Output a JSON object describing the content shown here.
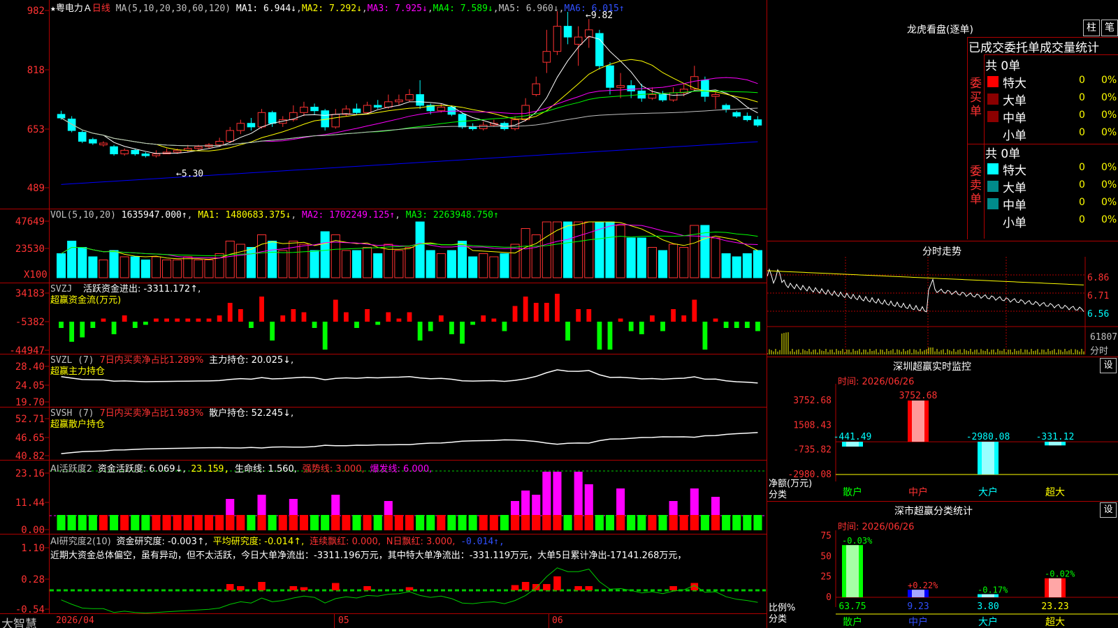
{
  "colors": {
    "up": "#ff3232",
    "down": "#00ffff",
    "grid": "#b00000",
    "ma1": "#ffffff",
    "ma2": "#ffff00",
    "ma3": "#ff00ff",
    "ma4": "#00ff00",
    "ma5": "#c0c0c0",
    "ma6": "#0000ff"
  },
  "header": {
    "stock_name": "粤电力Ａ",
    "period": "日线",
    "ma_params": "MA(5,10,20,30,60,120)",
    "ma1": "MA1: 6.944↓",
    "ma2": "MA2: 7.292↓",
    "ma3": "MA3: 7.925↓",
    "ma4": "MA4: 7.589↓",
    "ma5": "MA5: 6.960↓",
    "ma6": "MA6: 6.015↑"
  },
  "price_axis": [
    "982",
    "818",
    "653",
    "489"
  ],
  "annotations": {
    "high": "9.82",
    "low": "5.30"
  },
  "vol_header": {
    "label": "VOL(5,10,20)",
    "vol": "1635947.000↑",
    "ma1": "MA1: 1480683.375↓",
    "ma2": "MA2: 1702249.125↑",
    "ma3": "MA3: 2263948.750↑"
  },
  "vol_axis": [
    "47649",
    "23530",
    "X100"
  ],
  "svzj": {
    "label": "SVZJ",
    "text": "活跃资金进出: -3311.172↑,",
    "sub": "超赢资金流(万元)",
    "axis": [
      "34183",
      "-5382",
      "-44947"
    ]
  },
  "svzl": {
    "label": "SVZL (7)",
    "pct": "7日内买卖净占比1.289%",
    "hold": "主力持仓: 20.025↓,",
    "sub": "超赢主力持仓",
    "axis": [
      "28.40",
      "24.05",
      "19.70"
    ]
  },
  "svsh": {
    "label": "SVSH (7)",
    "pct": "7日内买卖净占比1.983%",
    "hold": "散户持仓: 52.245↓,",
    "sub": "超赢散户持仓",
    "axis": [
      "52.71",
      "46.65",
      "40.82"
    ]
  },
  "ai_active": {
    "label": "AI活跃度2",
    "a": "资金活跃度: 6.069↓,",
    "b": "23.159,",
    "c": "生命线: 1.560,",
    "d": "强势线: 3.000,",
    "e": "爆发线: 6.000,",
    "axis": [
      "23.16",
      "11.44",
      "0.00"
    ]
  },
  "ai_research": {
    "label": "AI研究度2(10)",
    "a": "资金研究度: -0.003↑,",
    "b": "平均研究度: -0.014↑,",
    "c": "连续飘红: 0.000,",
    "d": "N日飘红: 3.000,",
    "e": "-0.014↑,",
    "note": "近期大资金总体偏空，虽有异动，但不太活跃，今日大单净流出：-3311.196万元，其中特大单净流出：-331.119万元，大单5日累计净出-17141.268万元，",
    "axis": [
      "1.10",
      "0.28",
      "-0.54"
    ]
  },
  "bottom": {
    "brand": "大智慧",
    "date0": "2026/04",
    "m1": "05",
    "m2": "06"
  },
  "longhu": {
    "title": "龙虎看盘(逐单)",
    "btn1": "柱",
    "btn2": "笔",
    "subtitle": "已成交委托单成交量统计",
    "buy_label": "委买单",
    "sell_label": "委卖单",
    "buy_total": "共 0单",
    "sell_total": "共 0单",
    "rows": [
      "特大",
      "大单",
      "中单",
      "小单"
    ],
    "zero": "0",
    "pct": "0%"
  },
  "fenshi": {
    "title": "分时走势",
    "axis": [
      "6.86",
      "6.71",
      "6.56"
    ],
    "vol1": "61807",
    "vol2": "分时"
  },
  "sz_monitor": {
    "title": "深圳超赢实时监控",
    "time": "时间: 2026/06/26",
    "axis": [
      "3752.68",
      "1508.43",
      "-735.82",
      "-2980.08"
    ],
    "ylabel": "净额(万元)",
    "xlabel": "分类",
    "categories": [
      "散户",
      "中户",
      "大户",
      "超大"
    ],
    "values": [
      -441.49,
      3752.68,
      -2980.08,
      -331.12
    ],
    "labels": [
      "-441.49",
      "3752.68",
      "-2980.08",
      "-331.12"
    ],
    "set": "设"
  },
  "sz_class": {
    "title": "深市超赢分类统计",
    "time": "时间: 2026/06/26",
    "axis": [
      "75",
      "50",
      "25",
      "0"
    ],
    "ylabel": "比例%",
    "xlabel": "分类",
    "categories": [
      "散户",
      "中户",
      "大户",
      "超大"
    ],
    "values": [
      63.75,
      9.23,
      3.8,
      23.23
    ],
    "changes": [
      "-0.03%",
      "+0.22%",
      "-0.17%",
      "-0.02%"
    ],
    "labels": [
      "63.75",
      "9.23",
      "3.80",
      "23.23"
    ],
    "set": "设"
  },
  "chart_data": {
    "type": "candlestick",
    "title": "粤电力Ａ 日线",
    "ylim": [
      4.89,
      9.82
    ],
    "candles": [
      [
        6.95,
        6.85,
        7.05,
        6.8
      ],
      [
        6.82,
        6.5,
        6.9,
        6.45
      ],
      [
        6.45,
        6.2,
        6.5,
        6.15
      ],
      [
        6.25,
        6.15,
        6.3,
        6.1
      ],
      [
        6.1,
        6.15,
        6.2,
        6.05
      ],
      [
        6.05,
        5.85,
        6.1,
        5.8
      ],
      [
        5.85,
        5.95,
        6.0,
        5.8
      ],
      [
        5.95,
        5.85,
        6.0,
        5.8
      ],
      [
        5.85,
        5.8,
        5.9,
        5.75
      ],
      [
        5.8,
        5.85,
        5.95,
        5.75
      ],
      [
        5.85,
        5.9,
        6.0,
        5.85
      ],
      [
        5.9,
        5.95,
        6.0,
        5.85
      ],
      [
        5.95,
        6.0,
        6.1,
        5.9
      ],
      [
        6.0,
        6.05,
        6.1,
        5.95
      ],
      [
        6.05,
        6.1,
        6.15,
        6.0
      ],
      [
        6.1,
        6.2,
        6.3,
        6.05
      ],
      [
        6.2,
        6.5,
        6.6,
        6.15
      ],
      [
        6.5,
        6.7,
        6.8,
        6.4
      ],
      [
        6.7,
        6.6,
        6.85,
        6.5
      ],
      [
        6.6,
        7.0,
        7.1,
        6.55
      ],
      [
        7.0,
        6.7,
        7.05,
        6.6
      ],
      [
        6.7,
        6.8,
        6.9,
        6.6
      ],
      [
        6.8,
        7.0,
        7.2,
        6.75
      ],
      [
        7.0,
        7.15,
        7.3,
        6.9
      ],
      [
        7.15,
        7.05,
        7.25,
        6.95
      ],
      [
        7.05,
        6.6,
        7.1,
        6.5
      ],
      [
        6.6,
        6.95,
        7.1,
        6.55
      ],
      [
        6.95,
        7.1,
        7.2,
        6.9
      ],
      [
        7.1,
        7.0,
        7.25,
        6.95
      ],
      [
        7.0,
        7.2,
        7.3,
        6.95
      ],
      [
        7.2,
        7.15,
        7.35,
        7.1
      ],
      [
        7.15,
        7.3,
        7.5,
        7.1
      ],
      [
        7.3,
        7.35,
        7.5,
        7.2
      ],
      [
        7.35,
        7.5,
        7.65,
        7.3
      ],
      [
        7.5,
        7.2,
        7.9,
        7.1
      ],
      [
        7.2,
        7.05,
        7.25,
        6.95
      ],
      [
        7.05,
        7.15,
        7.25,
        7.0
      ],
      [
        7.15,
        6.95,
        7.2,
        6.9
      ],
      [
        6.95,
        6.6,
        7.0,
        6.55
      ],
      [
        6.6,
        6.55,
        6.7,
        6.5
      ],
      [
        6.55,
        6.65,
        6.75,
        6.5
      ],
      [
        6.65,
        6.7,
        6.8,
        6.6
      ],
      [
        6.7,
        6.55,
        6.75,
        6.5
      ],
      [
        6.55,
        6.8,
        6.9,
        6.5
      ],
      [
        6.8,
        7.2,
        7.4,
        6.75
      ],
      [
        7.5,
        7.8,
        8.0,
        7.45
      ],
      [
        8.4,
        8.7,
        9.3,
        8.1
      ],
      [
        8.7,
        9.4,
        9.82,
        8.6
      ],
      [
        9.4,
        9.1,
        9.8,
        8.9
      ],
      [
        8.9,
        9.1,
        9.4,
        8.3
      ],
      [
        9.1,
        9.3,
        9.6,
        8.8
      ],
      [
        9.2,
        8.3,
        9.3,
        8.2
      ],
      [
        8.3,
        7.7,
        8.4,
        7.5
      ],
      [
        7.7,
        7.75,
        8.1,
        7.4
      ],
      [
        7.75,
        7.6,
        7.9,
        7.4
      ],
      [
        7.6,
        7.4,
        7.8,
        7.3
      ],
      [
        7.4,
        7.5,
        7.7,
        7.35
      ],
      [
        7.5,
        7.35,
        7.6,
        7.3
      ],
      [
        7.35,
        7.55,
        7.7,
        7.3
      ],
      [
        7.55,
        7.65,
        7.8,
        7.45
      ],
      [
        7.65,
        8.0,
        8.3,
        7.6
      ],
      [
        7.9,
        7.45,
        8.0,
        7.3
      ],
      [
        7.45,
        7.5,
        7.6,
        7.1
      ],
      [
        7.2,
        7.1,
        7.25,
        7.0
      ],
      [
        7.0,
        6.9,
        7.05,
        6.85
      ],
      [
        6.9,
        6.8,
        7.0,
        6.75
      ],
      [
        6.8,
        6.65,
        6.9,
        6.6
      ]
    ]
  }
}
